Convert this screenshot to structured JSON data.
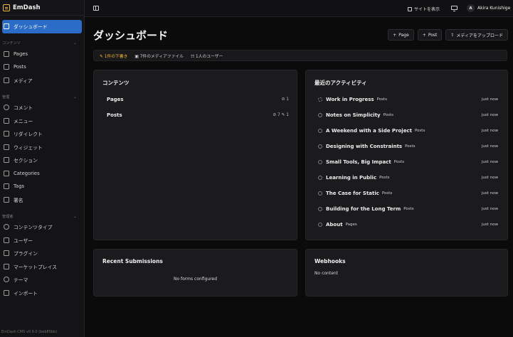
{
  "brand": {
    "name": "EmDash",
    "accent": "#f2b935"
  },
  "sidebar": {
    "top_items": [
      {
        "label": "ダッシュボード",
        "icon": "dashboard-icon",
        "active": true
      }
    ],
    "sections": [
      {
        "label": "コンテンツ",
        "items": [
          {
            "label": "Pages",
            "icon": "page-icon"
          },
          {
            "label": "Posts",
            "icon": "page-icon"
          },
          {
            "label": "メディア",
            "icon": "image-icon"
          }
        ]
      },
      {
        "label": "管理",
        "items": [
          {
            "label": "コメント",
            "icon": "comment-icon"
          },
          {
            "label": "メニュー",
            "icon": "menu-icon"
          },
          {
            "label": "リダイレクト",
            "icon": "redirect-icon"
          },
          {
            "label": "ウィジェット",
            "icon": "widget-icon"
          },
          {
            "label": "セクション",
            "icon": "section-icon"
          },
          {
            "label": "Categories",
            "icon": "page-icon"
          },
          {
            "label": "Tags",
            "icon": "page-icon"
          },
          {
            "label": "署名",
            "icon": "page-icon"
          }
        ]
      },
      {
        "label": "管理者",
        "items": [
          {
            "label": "コンテンツタイプ",
            "icon": "database-icon"
          },
          {
            "label": "ユーザー",
            "icon": "users-icon"
          },
          {
            "label": "プラグイン",
            "icon": "plugin-icon"
          },
          {
            "label": "マーケットプレイス",
            "icon": "store-icon"
          },
          {
            "label": "テーマ",
            "icon": "palette-icon"
          },
          {
            "label": "インポート",
            "icon": "import-icon"
          }
        ]
      }
    ],
    "version": "EmDash CMS v0.9.0 (beb85bb)"
  },
  "topbar": {
    "view_site": "サイトを表示",
    "user_initial": "A",
    "user_name": "Akira Kunishige"
  },
  "page": {
    "title": "ダッシュボード",
    "actions": [
      {
        "label": "Page",
        "icon": "plus-icon"
      },
      {
        "label": "Post",
        "icon": "plus-icon"
      },
      {
        "label": "メディアをアップロード",
        "icon": "upload-icon"
      }
    ],
    "stats": {
      "drafts": "1件の下書き",
      "media": "7件のメディアファイル",
      "users": "1人のユーザー"
    }
  },
  "content_card": {
    "title": "コンテンツ",
    "rows": [
      {
        "label": "Pages",
        "counts": "⊘ 1"
      },
      {
        "label": "Posts",
        "counts": "⊘ 7   ✎ 1"
      }
    ]
  },
  "activity_card": {
    "title": "最近のアクティビティ",
    "items": [
      {
        "title": "Work in Progress",
        "type": "Posts",
        "time": "just now"
      },
      {
        "title": "Notes on Simplicity",
        "type": "Posts",
        "time": "just now"
      },
      {
        "title": "A Weekend with a Side Project",
        "type": "Posts",
        "time": "just now"
      },
      {
        "title": "Designing with Constraints",
        "type": "Posts",
        "time": "just now"
      },
      {
        "title": "Small Tools, Big Impact",
        "type": "Posts",
        "time": "just now"
      },
      {
        "title": "Learning in Public",
        "type": "Posts",
        "time": "just now"
      },
      {
        "title": "The Case for Static",
        "type": "Posts",
        "time": "just now"
      },
      {
        "title": "Building for the Long Term",
        "type": "Posts",
        "time": "just now"
      },
      {
        "title": "About",
        "type": "Pages",
        "time": "just now"
      }
    ]
  },
  "submissions_card": {
    "title": "Recent Submissions",
    "empty": "No forms configured"
  },
  "webhooks_card": {
    "title": "Webhooks",
    "empty": "No content"
  }
}
